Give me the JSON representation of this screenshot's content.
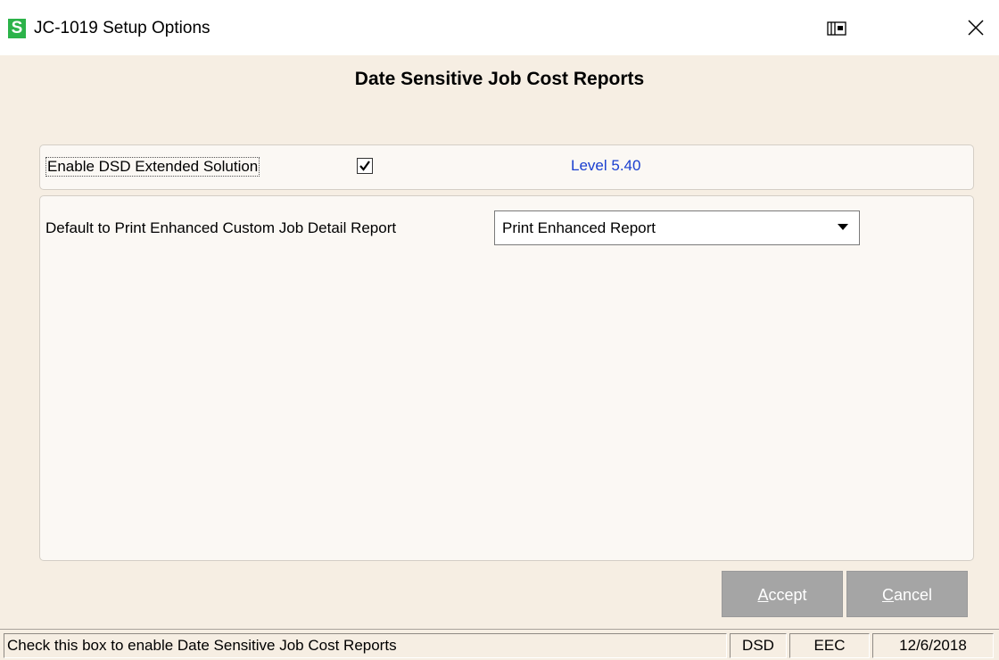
{
  "window": {
    "title": "JC-1019 Setup Options",
    "logo_letter": "S",
    "logo_color": "#2cb34a"
  },
  "header": {
    "title": "Date Sensitive Job Cost Reports"
  },
  "options": {
    "enable_label": "Enable DSD Extended Solution",
    "enable_checked": true,
    "level_text": "Level  5.40",
    "level_color": "#1a3fd0",
    "default_label": "Default to Print Enhanced Custom Job Detail Report",
    "default_value": "Print Enhanced Report"
  },
  "buttons": {
    "accept_underline": "A",
    "accept_rest": "ccept",
    "cancel_underline": "C",
    "cancel_rest": "ancel"
  },
  "statusbar": {
    "message": "Check this box to enable Date Sensitive Job Cost Reports",
    "company_code_1": "DSD",
    "company_code_2": "EEC",
    "date": "12/6/2018"
  },
  "icons": {
    "logo": "app-logo-icon",
    "restore": "restore-window-icon",
    "close": "close-icon",
    "checkbox": "checkmark-icon",
    "dropdown": "chevron-down-icon"
  }
}
